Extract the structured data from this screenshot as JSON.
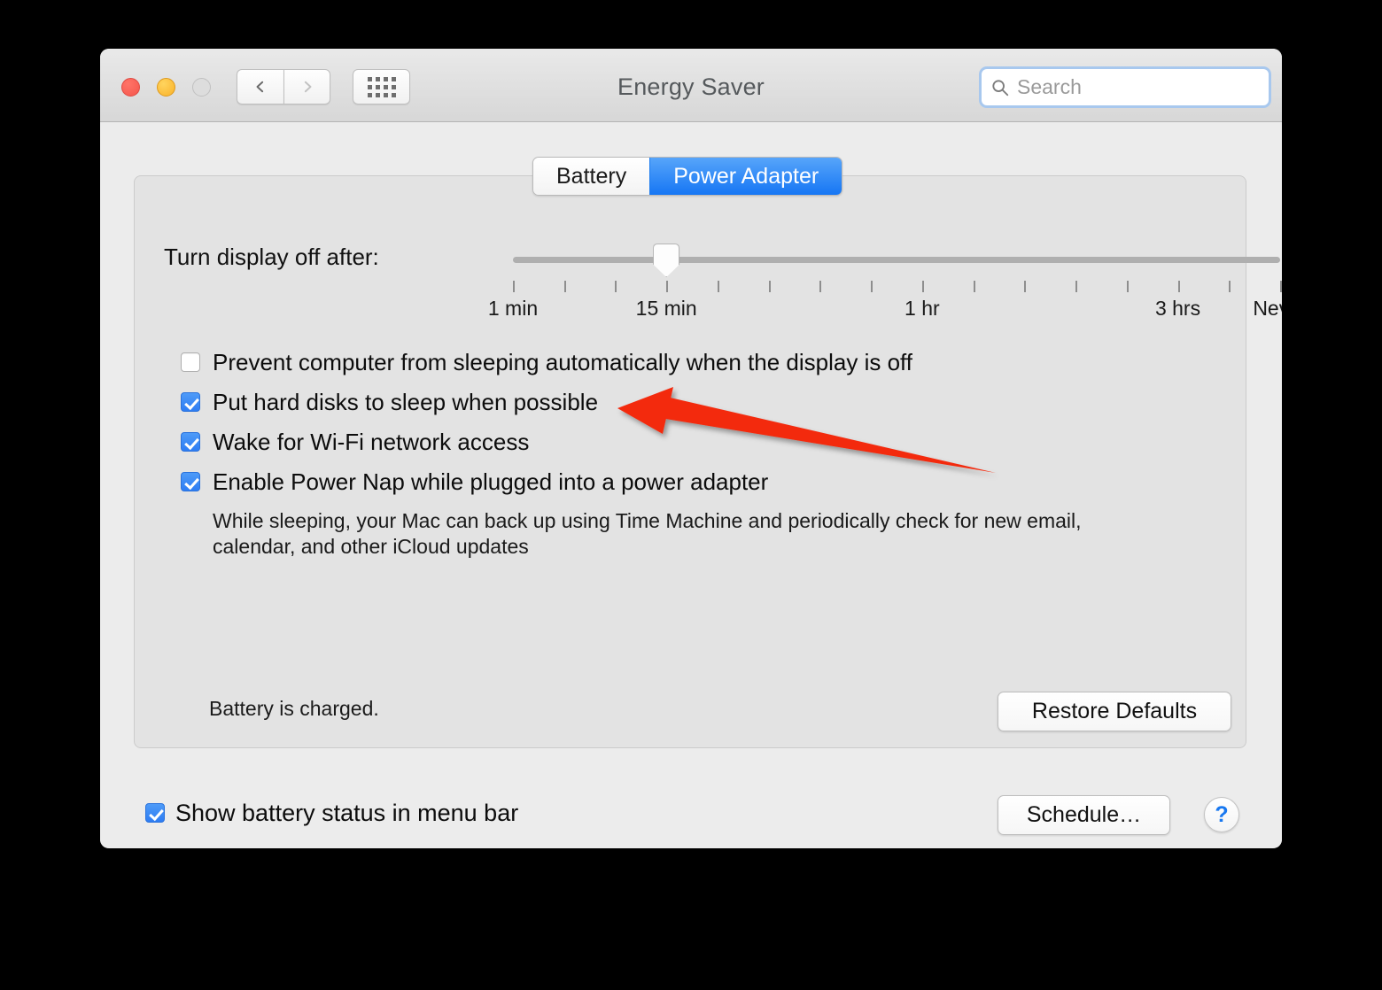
{
  "window": {
    "title": "Energy Saver",
    "traffic_lights": [
      "close-button",
      "minimize-button",
      "zoom-button"
    ],
    "nav": {
      "back_icon": "chevron-left-icon",
      "forward_icon": "chevron-right-icon",
      "show_all_icon": "grid-icon"
    },
    "search": {
      "placeholder": "Search",
      "value": "",
      "icon": "search-icon"
    }
  },
  "tabs": [
    {
      "label": "Battery",
      "active": false
    },
    {
      "label": "Power Adapter",
      "active": true
    }
  ],
  "slider": {
    "label": "Turn display off after:",
    "value_index": 3,
    "tick_count": 16,
    "tick_labels": [
      {
        "text": "1 min",
        "tick": 0
      },
      {
        "text": "15 min",
        "tick": 3
      },
      {
        "text": "1 hr",
        "tick": 8
      },
      {
        "text": "3 hrs",
        "tick": 13
      },
      {
        "text": "Never",
        "tick": 15
      }
    ]
  },
  "options": [
    {
      "label": "Prevent computer from sleeping automatically when the display is off",
      "checked": false
    },
    {
      "label": "Put hard disks to sleep when possible",
      "checked": true
    },
    {
      "label": "Wake for Wi-Fi network access",
      "checked": true
    },
    {
      "label": "Enable Power Nap while plugged into a power adapter",
      "checked": true
    }
  ],
  "power_nap_description": "While sleeping, your Mac can back up using Time Machine and periodically check for new email, calendar, and other iCloud updates",
  "status": {
    "battery_text": "Battery is charged."
  },
  "buttons": {
    "restore_defaults": "Restore Defaults",
    "schedule": "Schedule…",
    "help": "?"
  },
  "footer": {
    "show_battery_label": "Show battery status in menu bar",
    "show_battery_checked": true
  },
  "annotation": {
    "type": "arrow",
    "color": "#F32B11",
    "points_to": "Put hard disks to sleep when possible"
  },
  "colors": {
    "accent_blue": "#2E7DF3",
    "window_bg": "#ECECEC",
    "panel_bg": "#E3E3E3",
    "annotation_red": "#F32B11"
  }
}
